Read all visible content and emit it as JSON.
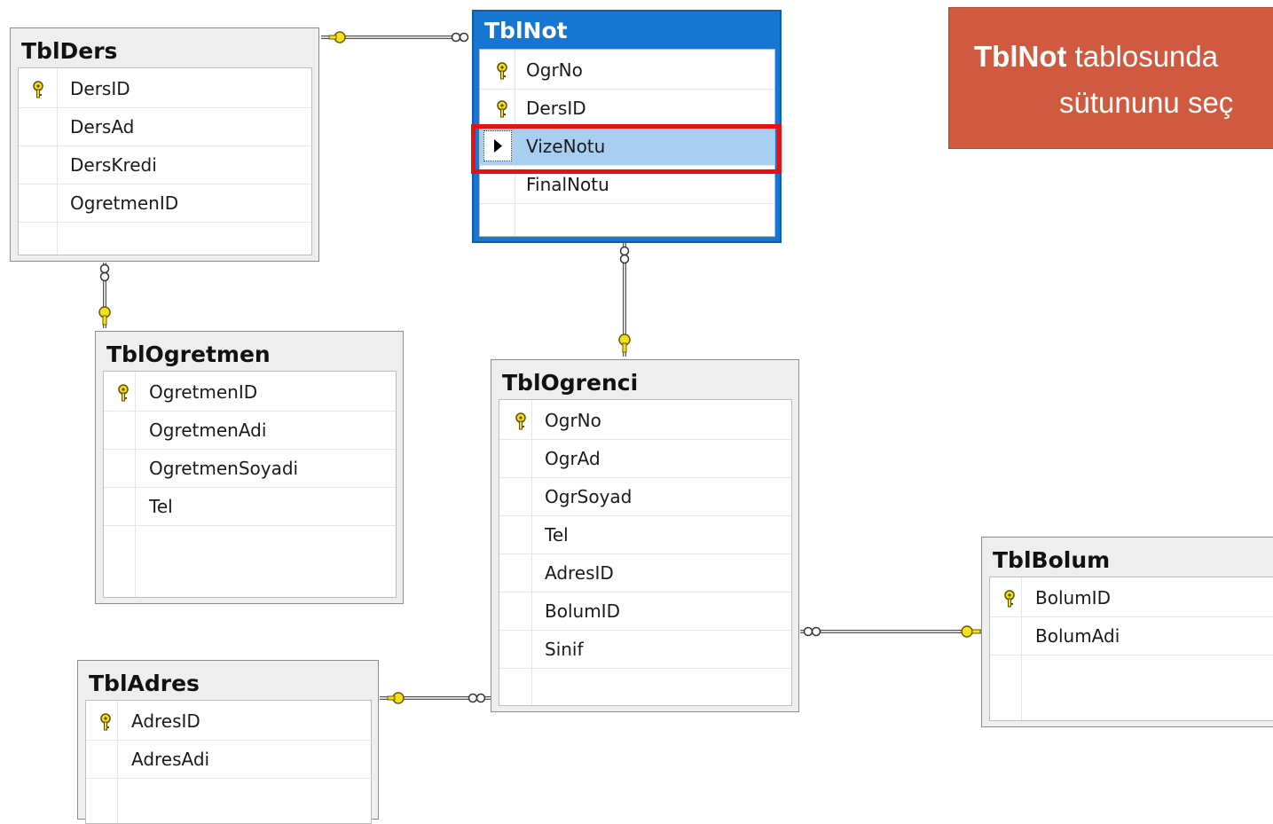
{
  "callout": {
    "line1_bold": "TblNot",
    "line1_rest": " tablosunda",
    "line2": "sütununu seç"
  },
  "tables": {
    "ders": {
      "title": "TblDers",
      "columns": [
        "DersID",
        "DersAd",
        "DersKredi",
        "OgretmenID"
      ]
    },
    "not": {
      "title": "TblNot",
      "columns": [
        "OgrNo",
        "DersID",
        "VizeNotu",
        "FinalNotu"
      ],
      "selected_column": "VizeNotu"
    },
    "ogretmen": {
      "title": "TblOgretmen",
      "columns": [
        "OgretmenID",
        "OgretmenAdi",
        "OgretmenSoyadi",
        "Tel"
      ]
    },
    "ogrenci": {
      "title": "TblOgrenci",
      "columns": [
        "OgrNo",
        "OgrAd",
        "OgrSoyad",
        "Tel",
        "AdresID",
        "BolumID",
        "Sinif"
      ]
    },
    "adres": {
      "title": "TblAdres",
      "columns": [
        "AdresID",
        "AdresAdi"
      ]
    },
    "bolum": {
      "title": "TblBolum",
      "columns": [
        "BolumID",
        "BolumAdi"
      ]
    }
  },
  "colors": {
    "active_header": "#1577d2",
    "selected_row": "#a8cff0",
    "highlight_border": "#e81010",
    "callout_bg": "#d05a3f",
    "key_icon": "#f0e000"
  }
}
